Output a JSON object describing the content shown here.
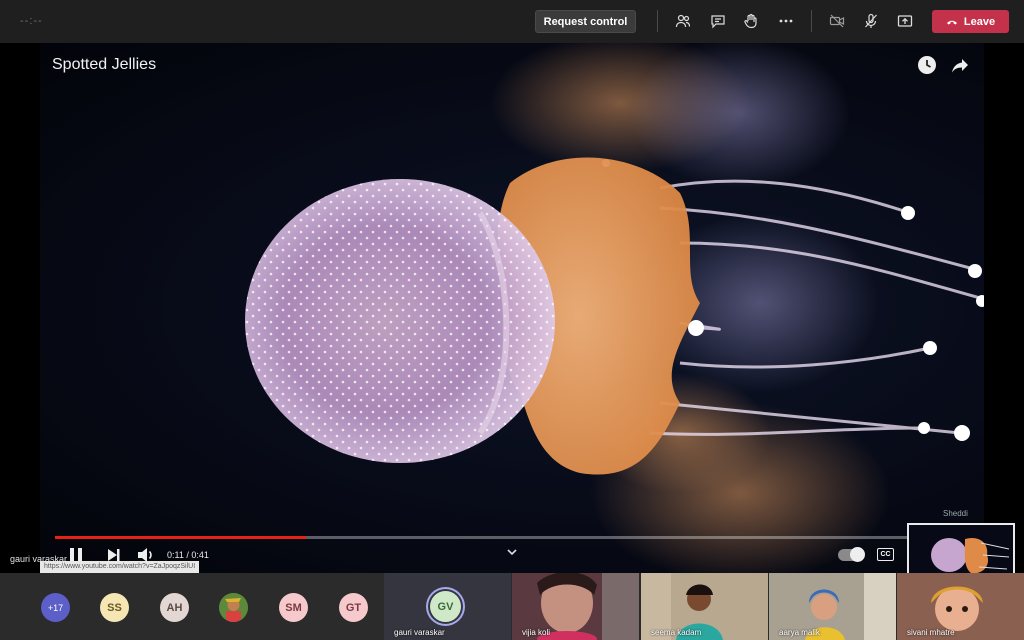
{
  "topbar": {
    "timer": "--:--",
    "request_control": "Request control",
    "leave_label": "Leave",
    "colors": {
      "leave": "#c4314b",
      "bar": "#1f1f1f"
    },
    "icons": [
      "people-icon",
      "chat-icon",
      "raise-hand-icon",
      "more-options-icon",
      "camera-off-icon",
      "mic-icon",
      "share-screen-icon",
      "phone-icon"
    ]
  },
  "video": {
    "title": "Spotted Jellies",
    "time": "0:11 / 0:41",
    "progress_percent": 27,
    "presenter": "gauri varaskar",
    "url": "https://www.youtube.com/watch?v=ZaJpoqzSilUI",
    "watermark": "Sheddi",
    "accent": "#e62117"
  },
  "participants": {
    "overflow": "+17",
    "avatars": [
      {
        "initials": "SS",
        "color": "#f5e6b3",
        "text_color": "#6a5a20"
      },
      {
        "initials": "AH",
        "color": "#e3d7d3",
        "text_color": "#5a4a45"
      },
      {
        "initials": "SM",
        "color": "#f6c9cc",
        "text_color": "#7a3a40"
      },
      {
        "initials": "GT",
        "color": "#f6c9cc",
        "text_color": "#7a3a40"
      }
    ],
    "active": {
      "initials": "GV",
      "name": "gauri varaskar",
      "color": "#cfe9c8"
    },
    "tiles": [
      {
        "name": "vijia koli"
      },
      {
        "name": "seema kadam"
      },
      {
        "name": "aarya malik"
      },
      {
        "name": "sivani mhatre"
      }
    ]
  }
}
